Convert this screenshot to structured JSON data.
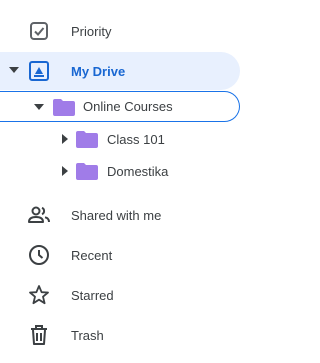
{
  "sidebar": {
    "items": [
      {
        "label": "Priority",
        "icon": "priority-checkbox-icon"
      },
      {
        "label": "My Drive",
        "icon": "drive-icon",
        "selected": true,
        "expanded": true
      },
      {
        "label": "Online Courses",
        "icon": "folder-icon",
        "expanded": true,
        "focused": true
      },
      {
        "label": "Class 101",
        "icon": "folder-icon",
        "expanded": false
      },
      {
        "label": "Domestika",
        "icon": "folder-icon",
        "expanded": false
      },
      {
        "label": "Shared with me",
        "icon": "people-icon"
      },
      {
        "label": "Recent",
        "icon": "clock-icon"
      },
      {
        "label": "Starred",
        "icon": "star-icon"
      },
      {
        "label": "Trash",
        "icon": "trash-icon"
      }
    ]
  },
  "colors": {
    "selected_bg": "#e8f0fe",
    "selected_text": "#1967d2",
    "folder": "#a07ce8",
    "focus_outline": "#1a73e8",
    "icon_gray": "#5f6368"
  }
}
